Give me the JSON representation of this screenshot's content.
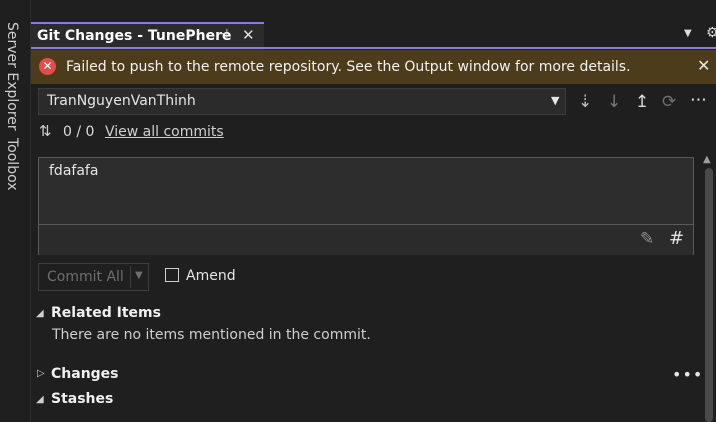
{
  "side_rail": {
    "server_explorer": "Server Explorer",
    "toolbox": "Toolbox"
  },
  "tab": {
    "title": "Git Changes - TunePhere",
    "pin_icon": "pin-icon",
    "close_icon": "close-icon"
  },
  "error_bar": {
    "message": "Failed to push to the remote repository. See the Output window for more details.",
    "icon": "error-icon",
    "color": "#4d3c1b"
  },
  "branch": {
    "selected": "TranNguyenVanThinh"
  },
  "toolbar": {
    "icons": [
      "fetch-icon",
      "pull-icon",
      "push-icon",
      "sync-icon",
      "more-icon"
    ]
  },
  "commits": {
    "count": "0 / 0",
    "view_all": "View all commits"
  },
  "message": {
    "text": "fdafafa"
  },
  "commit": {
    "button_label": "Commit All",
    "amend_label": "Amend"
  },
  "sections": {
    "related_title": "Related Items",
    "related_empty": "There are no items mentioned in the commit.",
    "changes_title": "Changes",
    "stashes_title": "Stashes"
  },
  "colors": {
    "accent": "#8a7ae6",
    "error": "#e24c4c",
    "background": "#1f1f1f"
  }
}
